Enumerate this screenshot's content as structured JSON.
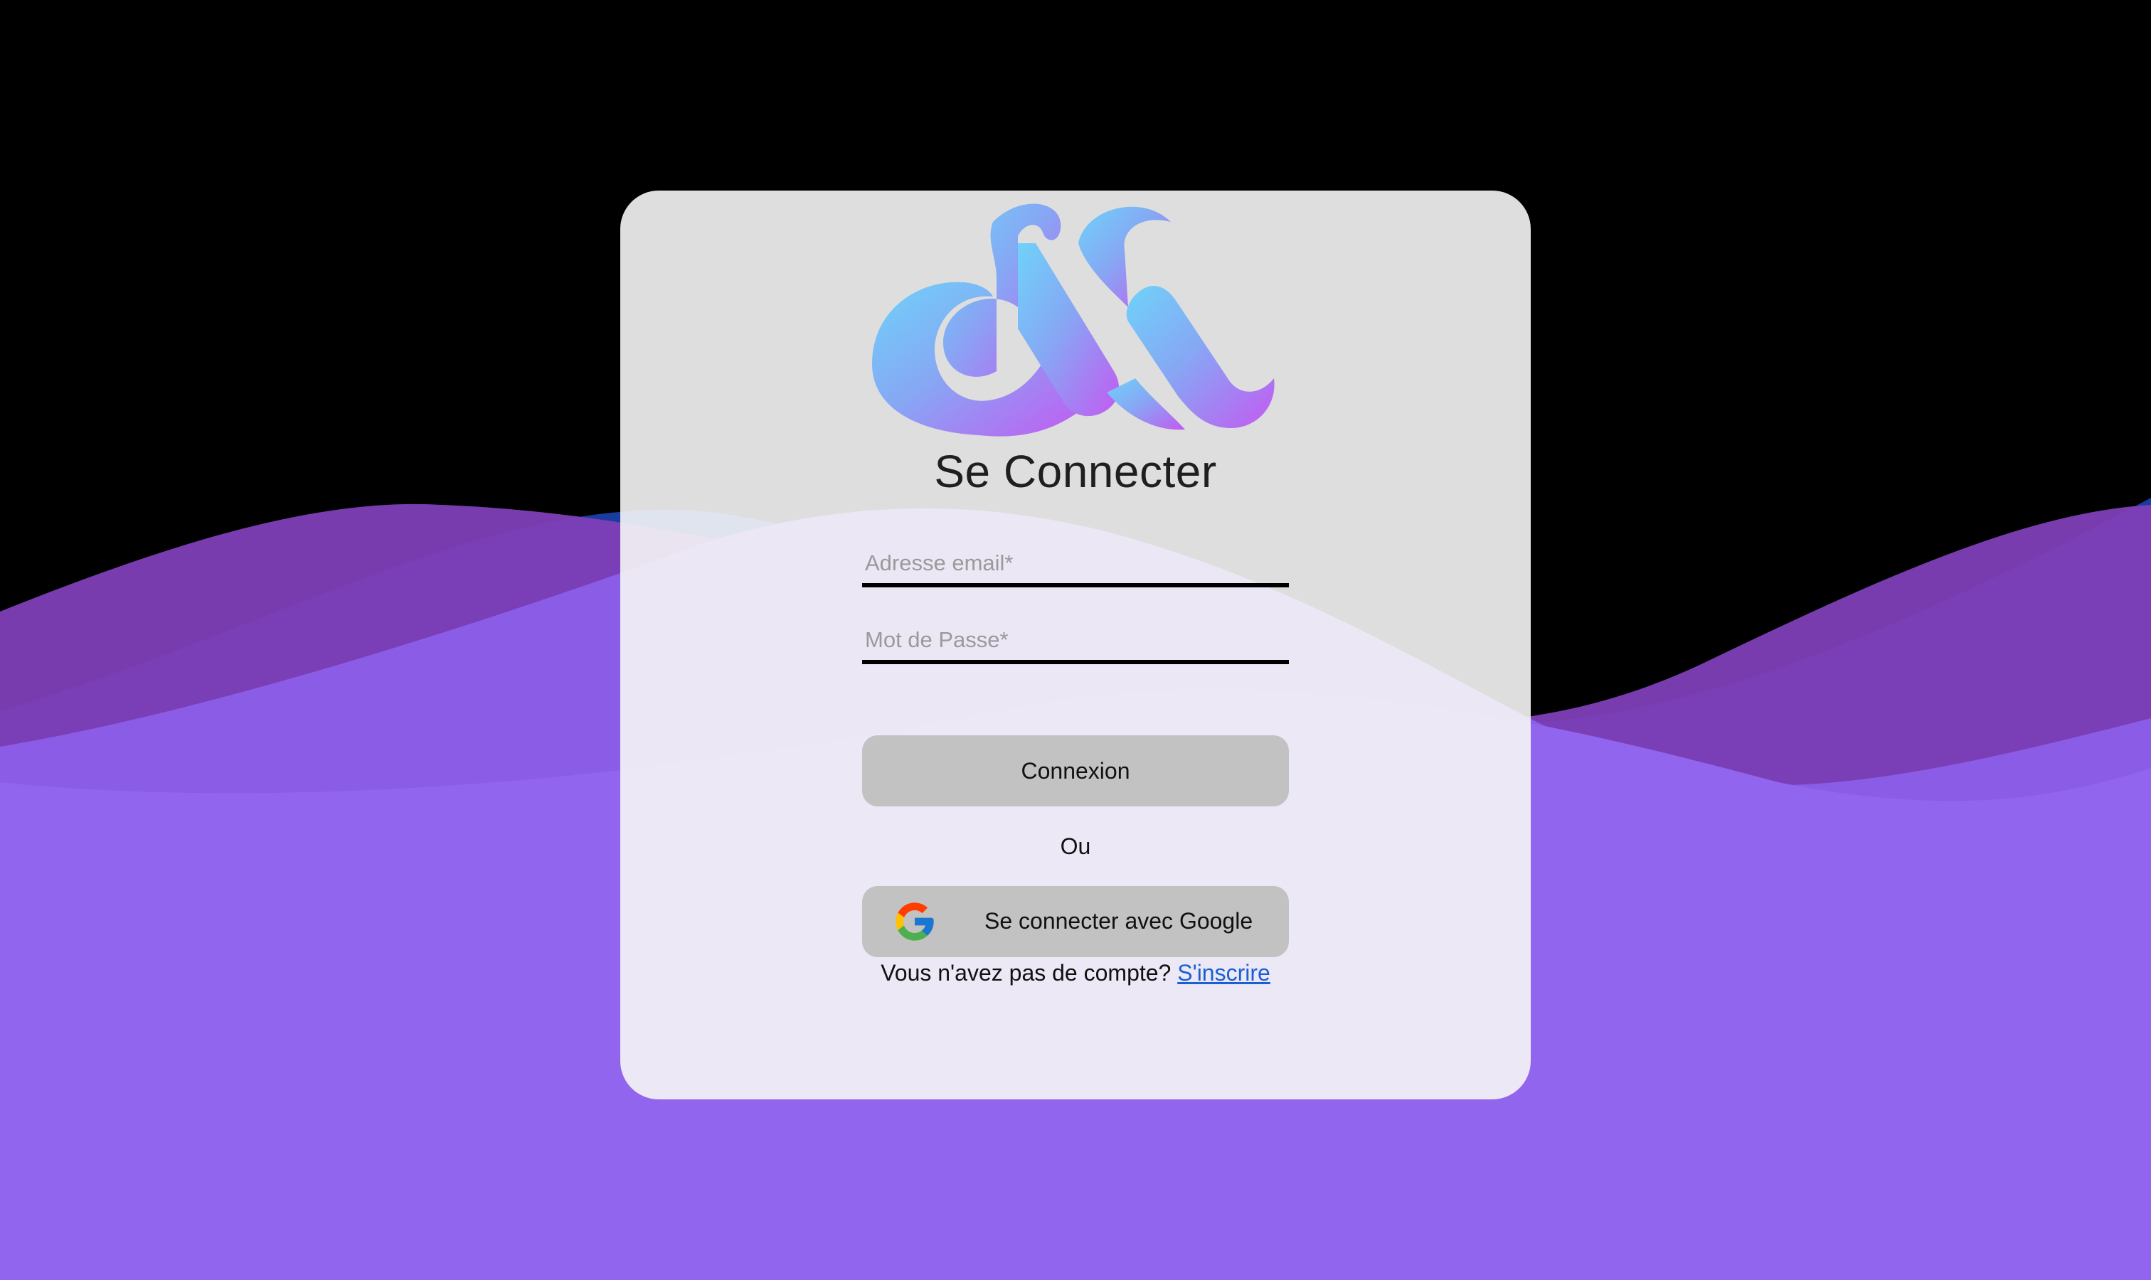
{
  "page": {
    "title": "Se Connecter"
  },
  "logo": {
    "name": "brand-logo",
    "gradient_start": "#6fd2fa",
    "gradient_end": "#c35af2"
  },
  "form": {
    "email_placeholder": "Adresse email*",
    "email_value": "",
    "password_placeholder": "Mot de Passe*",
    "password_value": "",
    "submit_label": "Connexion",
    "separator": "Ou",
    "google_label": "Se connecter avec Google",
    "google_icon": "google-icon",
    "no_account_text": "Vous n'avez pas de compte?",
    "signup_link": "S'inscrire"
  },
  "colors": {
    "background": "#000000",
    "wave_purple": "#9165ed",
    "button_gray": "#c2c2c2",
    "link_blue": "#1a5fd6"
  }
}
